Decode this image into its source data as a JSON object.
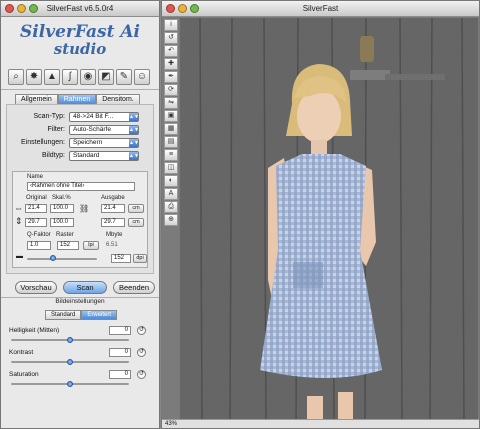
{
  "left_window": {
    "title": "SilverFast v6.5.0r4",
    "logo_line1": "SilverFast Ai",
    "logo_line2": "studio",
    "tools": [
      {
        "icon": "magnifier-icon",
        "glyph": "⌕"
      },
      {
        "icon": "levels-icon",
        "glyph": "✸"
      },
      {
        "icon": "histogram-icon",
        "glyph": "▲"
      },
      {
        "icon": "gradation-curve-icon",
        "glyph": "∫"
      },
      {
        "icon": "color-wheel-icon",
        "glyph": "◉"
      },
      {
        "icon": "selective-color-icon",
        "glyph": "◩"
      },
      {
        "icon": "brush-icon",
        "glyph": "✎"
      },
      {
        "icon": "portrait-icon",
        "glyph": "☺"
      }
    ],
    "tabs": [
      {
        "label": "Allgemein",
        "active": false
      },
      {
        "label": "Rahmen",
        "active": true
      },
      {
        "label": "Densitom.",
        "active": false
      }
    ],
    "settings": [
      {
        "label": "Scan-Typ:",
        "value": "48->24 Bit F..."
      },
      {
        "label": "Filter:",
        "value": "Auto-Schärfe"
      },
      {
        "label": "Einstellungen:",
        "value": "Speichern"
      },
      {
        "label": "Bildtyp:",
        "value": "Standard"
      }
    ],
    "name_label": "Name",
    "name_value": "‹Rahmen ohne Titel›",
    "original_label": "Original",
    "skal_label": "Skal.%",
    "ausgabe_label": "Ausgabe",
    "orig_w": "21.4",
    "orig_h": "29.7",
    "skal_w": "100.0",
    "skal_h": "100.0",
    "out_w": "21.4",
    "out_h": "29.7",
    "unit": "cm",
    "qfaktor_label": "Q-Faktor",
    "raster_label": "Raster",
    "mbyte_label": "Mbyte",
    "qfaktor_value": "1.0",
    "raster_value": "152",
    "raster_unit": "lpi",
    "mbyte_value": "6.51",
    "dpi_value": "152",
    "dpi_unit": "dpi",
    "buttons": {
      "preview": "Vorschau",
      "scan": "Scan",
      "quit": "Beenden"
    },
    "image_settings_title": "Bildeinstellungen",
    "modes": [
      {
        "label": "Standard",
        "active": false
      },
      {
        "label": "Erweitert",
        "active": true
      }
    ],
    "adjustments": [
      {
        "label": "Helligkeit (Mitten)",
        "value": "0"
      },
      {
        "label": "Kontrast",
        "value": "0"
      },
      {
        "label": "Saturation",
        "value": "0"
      }
    ]
  },
  "right_window": {
    "title": "SilverFast",
    "vtools": [
      {
        "icon": "info-icon",
        "glyph": "i"
      },
      {
        "icon": "reset-icon",
        "glyph": "↺"
      },
      {
        "icon": "undo-icon",
        "glyph": "↶"
      },
      {
        "icon": "pipette-icon",
        "glyph": "✚"
      },
      {
        "icon": "eyedropper-icon",
        "glyph": "✒"
      },
      {
        "icon": "rotate-icon",
        "glyph": "⟳"
      },
      {
        "icon": "mirror-icon",
        "glyph": "⇋"
      },
      {
        "icon": "crop-icon",
        "glyph": "▣"
      },
      {
        "icon": "frame-icon",
        "glyph": "▦"
      },
      {
        "icon": "grid-icon",
        "glyph": "▤"
      },
      {
        "icon": "stack-icon",
        "glyph": "≡"
      },
      {
        "icon": "overlay-icon",
        "glyph": "◫"
      },
      {
        "icon": "color-icon",
        "glyph": "◐"
      },
      {
        "icon": "text-icon",
        "glyph": "A"
      },
      {
        "icon": "print-icon",
        "glyph": "⎙"
      },
      {
        "icon": "zoom-icon",
        "glyph": "⊕"
      }
    ],
    "zoom": "43%"
  },
  "colors": {
    "accent": "#4e8ad8",
    "logo": "#3d66a6"
  }
}
